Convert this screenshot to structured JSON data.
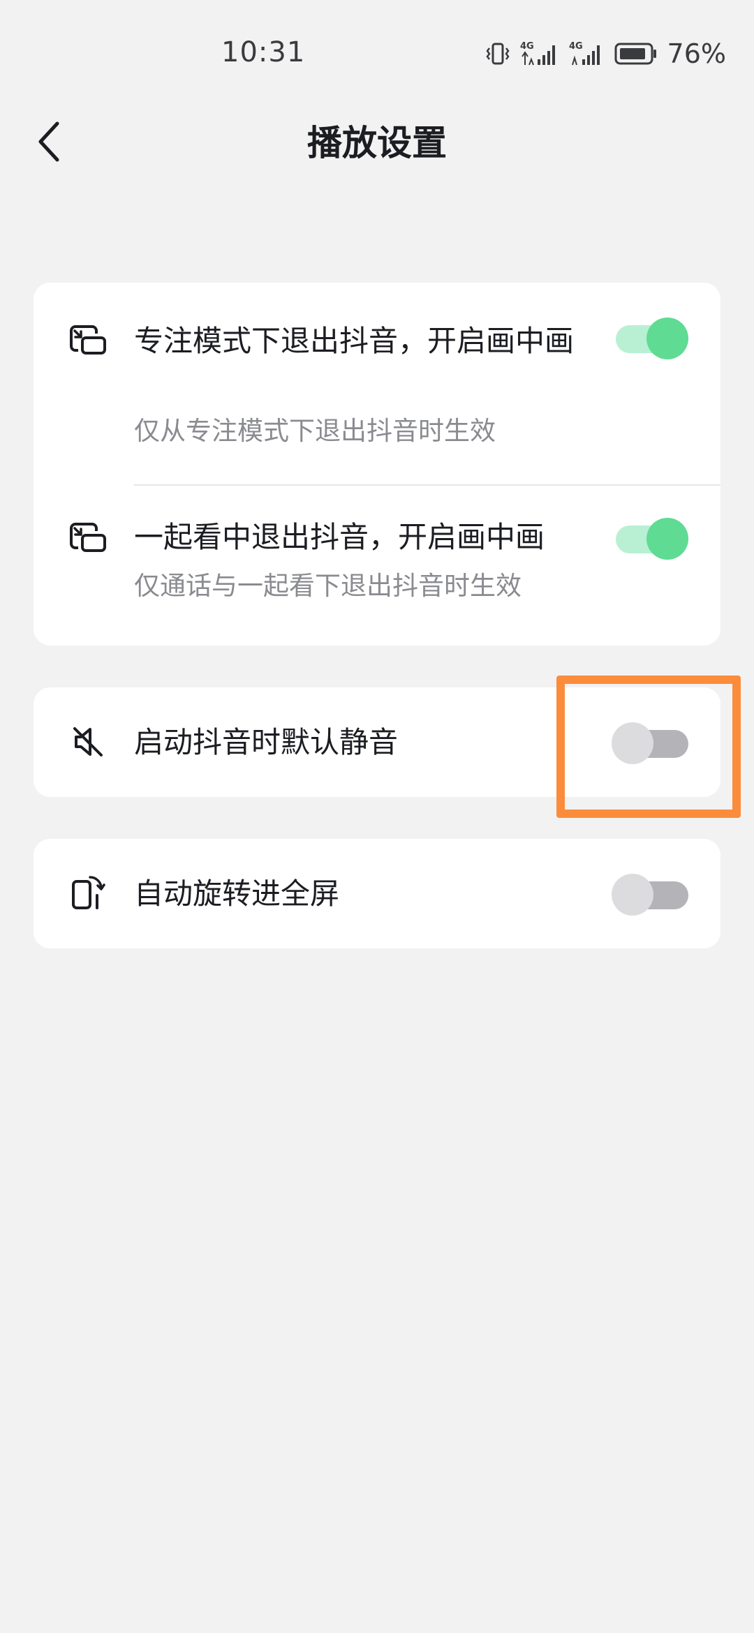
{
  "status_bar": {
    "time": "10:31",
    "battery_percent": "76%",
    "signal_label_1": "4G",
    "signal_label_2": "4G",
    "battery_level": 0.76
  },
  "header": {
    "title": "播放设置",
    "back_icon": "chevron-left-icon"
  },
  "settings": {
    "focus_pip": {
      "title": "专注模式下退出抖音，开启画中画",
      "subtitle": "仅从专注模式下退出抖音时生效",
      "enabled": true,
      "icon": "picture-in-picture-icon"
    },
    "watch_together_pip": {
      "title": "一起看中退出抖音，开启画中画",
      "subtitle": "仅通话与一起看下退出抖音时生效",
      "enabled": true,
      "icon": "picture-in-picture-icon"
    },
    "mute_on_start": {
      "title": "启动抖音时默认静音",
      "enabled": false,
      "icon": "mute-icon"
    },
    "auto_rotate": {
      "title": "自动旋转进全屏",
      "enabled": false,
      "icon": "rotate-screen-icon"
    }
  },
  "colors": {
    "toggle_on_knob": "#5fdb94",
    "toggle_on_track": "#b9f0d4",
    "toggle_off_knob": "#dcdcde",
    "toggle_off_track": "#b3b3b8",
    "highlight": "#fb8c3c",
    "background": "#f2f2f2"
  }
}
